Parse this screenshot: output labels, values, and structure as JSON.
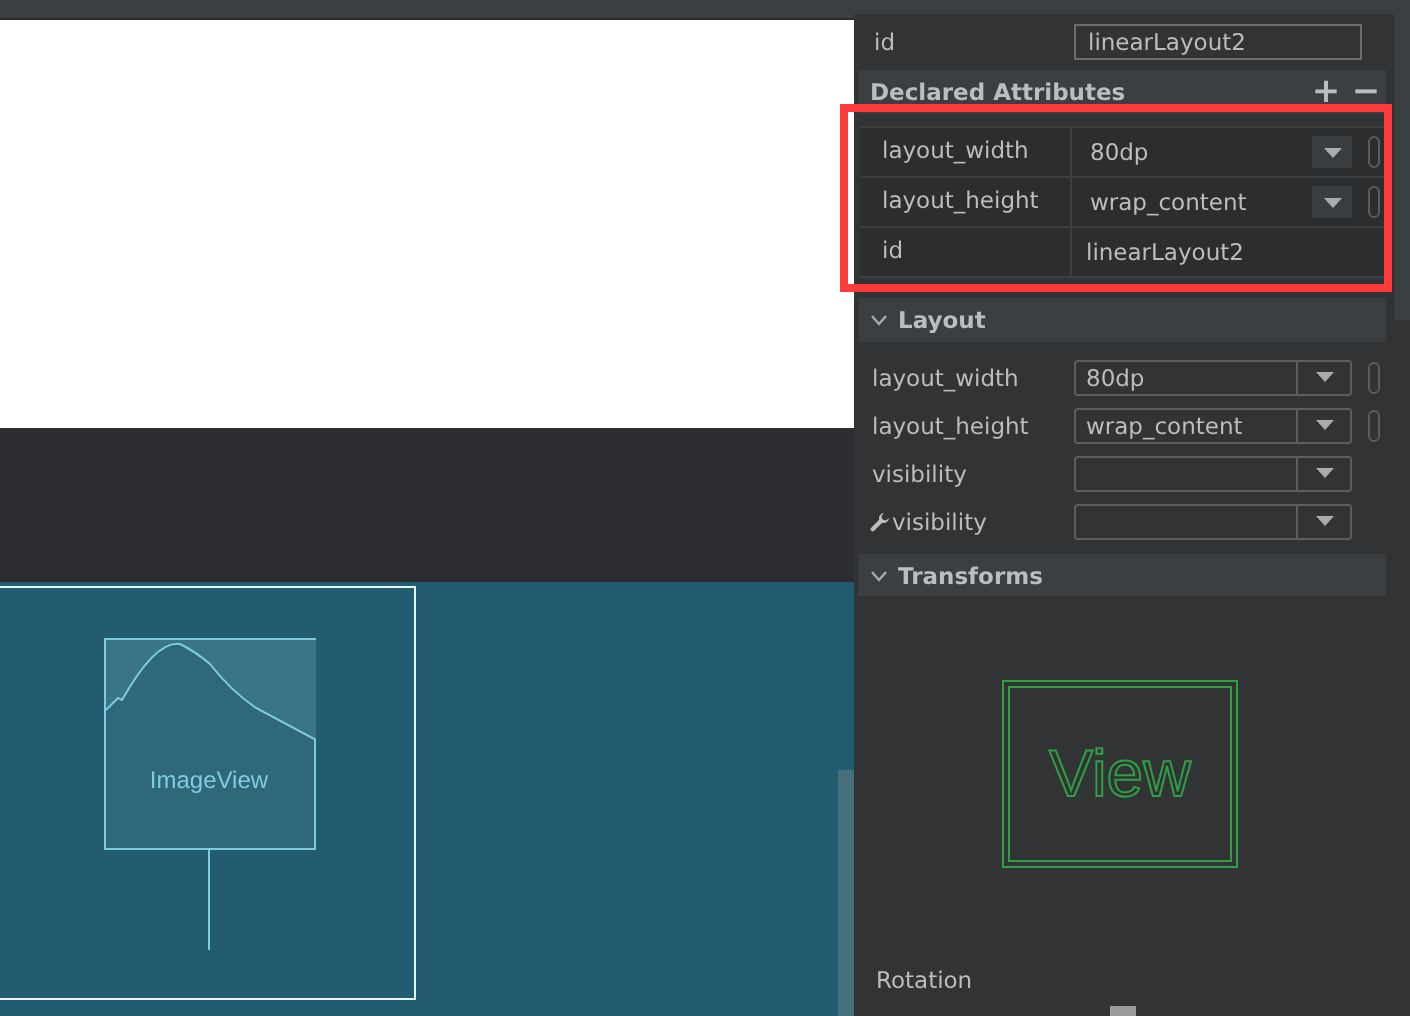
{
  "canvas": {
    "label": "ImageView"
  },
  "id_field": {
    "label": "id",
    "value": "linearLayout2"
  },
  "declared": {
    "title": "Declared Attributes",
    "add": "+",
    "remove": "−",
    "rows": [
      {
        "kind": "dropdown",
        "name": "layout_width",
        "value": "80dp"
      },
      {
        "kind": "dropdown",
        "name": "layout_height",
        "value": "wrap_content"
      },
      {
        "kind": "text",
        "name": "id",
        "value": "linearLayout2"
      }
    ]
  },
  "layout": {
    "title": "Layout",
    "rows": [
      {
        "kind": "pinned",
        "name": "layout_width",
        "value": "80dp"
      },
      {
        "kind": "pinned",
        "name": "layout_height",
        "value": "wrap_content"
      },
      {
        "kind": "plain",
        "name": "visibility"
      },
      {
        "kind": "tools",
        "name": "visibility"
      }
    ]
  },
  "transforms": {
    "title": "Transforms",
    "preview": "View",
    "rotation_label": "Rotation"
  }
}
